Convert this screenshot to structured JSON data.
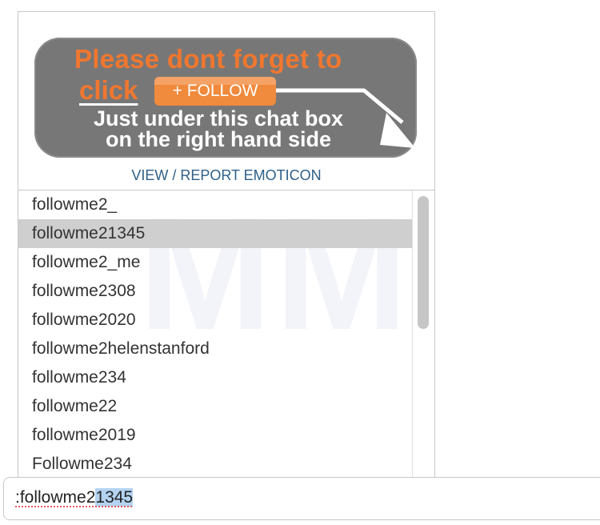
{
  "emoticon_banner": {
    "line1": "Please dont forget to",
    "click_word": "click",
    "follow_button": "+ FOLLOW",
    "line3": "Just under this chat box",
    "line4": "on the right hand side",
    "orange_color": "#f0772f",
    "banner_color": "#777777"
  },
  "view_report_label": "VIEW / REPORT EMOTICON",
  "watermark": "MM",
  "suggestions": {
    "selected_index": 1,
    "items": [
      {
        "label": "followme2_"
      },
      {
        "label": "followme21345"
      },
      {
        "label": "followme2_me"
      },
      {
        "label": "followme2308"
      },
      {
        "label": "followme2020"
      },
      {
        "label": "followme2helenstanford"
      },
      {
        "label": "followme234"
      },
      {
        "label": "followme22"
      },
      {
        "label": "followme2019"
      },
      {
        "label": "Followme234"
      }
    ]
  },
  "chat_input": {
    "typed_prefix": ":followme2",
    "autocompleted_selection": "1345"
  }
}
